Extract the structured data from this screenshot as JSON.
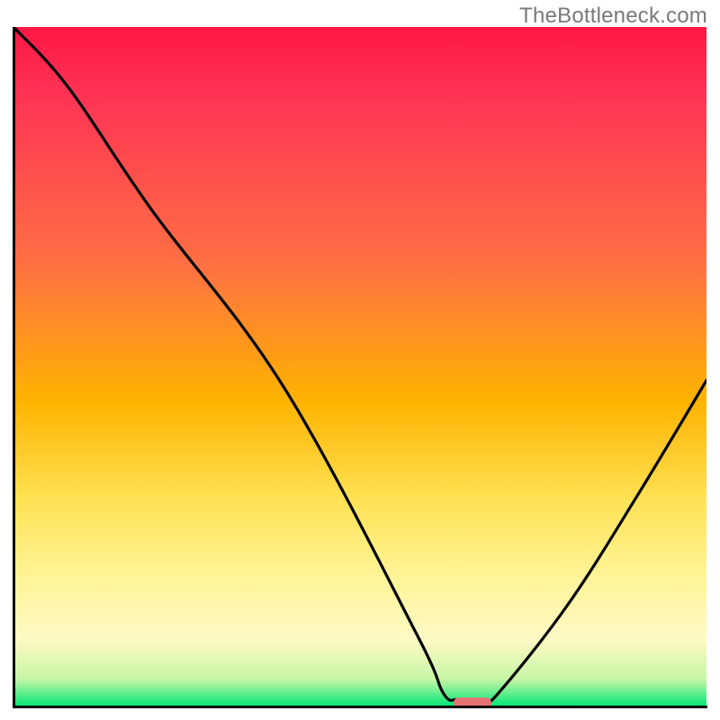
{
  "watermark": "TheBottleneck.com",
  "chart_data": {
    "type": "line",
    "title": "",
    "xlabel": "",
    "ylabel": "",
    "xlim": [
      0,
      100
    ],
    "ylim": [
      0,
      100
    ],
    "series": [
      {
        "name": "bottleneck-curve",
        "x": [
          0,
          8,
          20,
          39,
          58,
          62,
          64,
          66,
          68,
          70,
          80,
          90,
          100
        ],
        "values": [
          100,
          91,
          73,
          47,
          11,
          2,
          1,
          1,
          1,
          2,
          15,
          31,
          48
        ]
      }
    ],
    "marker": {
      "name": "optimal-range",
      "x_start": 63.5,
      "x_end": 69,
      "y": 0.5,
      "color": "#e57373"
    },
    "gradient_stops": [
      {
        "pos": 0.0,
        "color": "#ff1744"
      },
      {
        "pos": 0.35,
        "color": "#ff7043"
      },
      {
        "pos": 0.7,
        "color": "#ffe357"
      },
      {
        "pos": 1.0,
        "color": "#00e676"
      }
    ]
  }
}
